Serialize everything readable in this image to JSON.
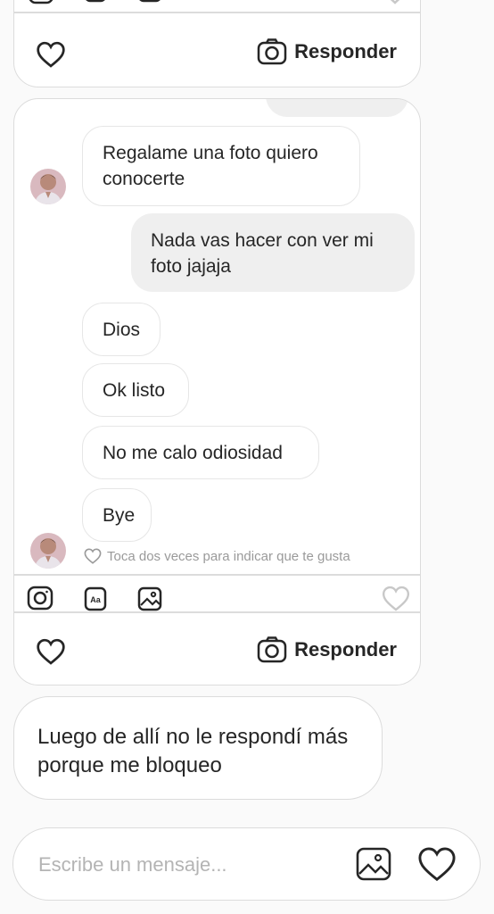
{
  "top_card": {
    "reply_label": "Responder"
  },
  "thread": {
    "messages": [
      {
        "side": "in",
        "text": "Regalame una foto quiero conocerte"
      },
      {
        "side": "out",
        "text": "Nada vas hacer con ver mi foto jajaja"
      },
      {
        "side": "in",
        "text": "Dios"
      },
      {
        "side": "in",
        "text": "Ok listo"
      },
      {
        "side": "in",
        "text": "No me calo odiosidad"
      },
      {
        "side": "in",
        "text": "Bye"
      }
    ],
    "like_hint": "Toca dos veces para indicar que te gusta",
    "reply_label": "Responder"
  },
  "comment": {
    "text": "Luego de allí no le respondí más porque me bloqueo"
  },
  "composer": {
    "placeholder": "Escribe un mensaje..."
  },
  "colors": {
    "border": "#dcdcdc",
    "outgoing_bubble": "#efefef",
    "text": "#262626",
    "muted": "#9a9a9a"
  }
}
